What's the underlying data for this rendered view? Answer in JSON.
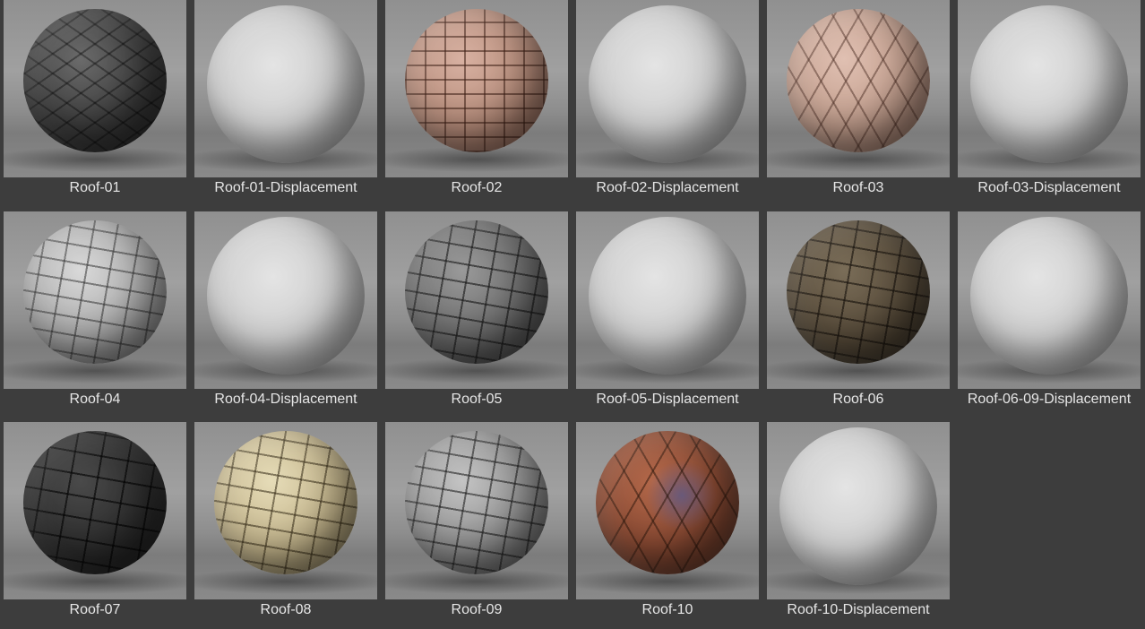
{
  "items": [
    {
      "label": "Roof-01",
      "material": "dark-slate"
    },
    {
      "label": "Roof-01-Displacement",
      "material": "displacement"
    },
    {
      "label": "Roof-02",
      "material": "terracotta"
    },
    {
      "label": "Roof-02-Displacement",
      "material": "displacement"
    },
    {
      "label": "Roof-03",
      "material": "hex-terracotta"
    },
    {
      "label": "Roof-03-Displacement",
      "material": "displacement"
    },
    {
      "label": "Roof-04",
      "material": "light-stone"
    },
    {
      "label": "Roof-04-Displacement",
      "material": "displacement"
    },
    {
      "label": "Roof-05",
      "material": "grey-stone"
    },
    {
      "label": "Roof-05-Displacement",
      "material": "displacement"
    },
    {
      "label": "Roof-06",
      "material": "brown-stone"
    },
    {
      "label": "Roof-06-09-Displacement",
      "material": "displacement"
    },
    {
      "label": "Roof-07",
      "material": "black-stone"
    },
    {
      "label": "Roof-08",
      "material": "sand-stone"
    },
    {
      "label": "Roof-09",
      "material": "silver-stone"
    },
    {
      "label": "Roof-10",
      "material": "rust-stone"
    },
    {
      "label": "Roof-10-Displacement",
      "material": "displacement"
    }
  ],
  "colors": {
    "background": "#3d3d3d",
    "label_text": "#e6e6e6"
  }
}
